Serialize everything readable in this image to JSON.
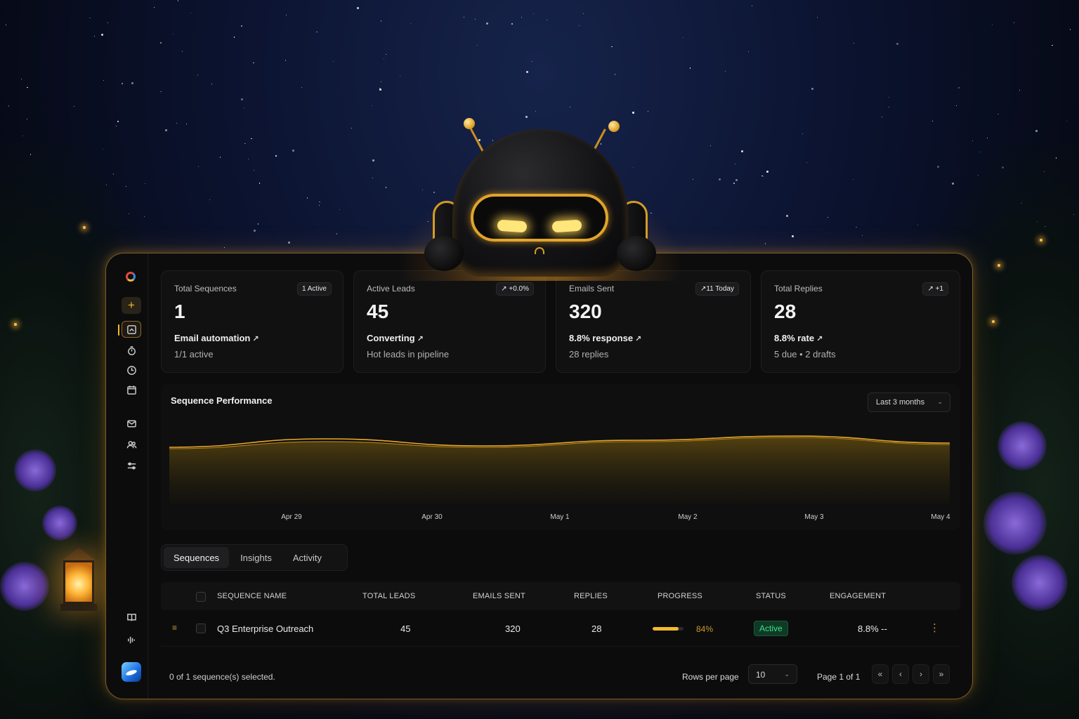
{
  "colors": {
    "accent": "#f2b930",
    "status_active": "#3ee08a",
    "panel_bg": "#0c0c0d"
  },
  "sidebar": {
    "items": [
      {
        "name": "add",
        "icon": "plus-icon"
      },
      {
        "name": "dashboard",
        "icon": "dashboard-icon"
      },
      {
        "name": "timer",
        "icon": "timer-icon"
      },
      {
        "name": "history",
        "icon": "clock-icon"
      },
      {
        "name": "calendar",
        "icon": "calendar-icon"
      },
      {
        "name": "mail",
        "icon": "mail-icon"
      },
      {
        "name": "users",
        "icon": "users-icon"
      },
      {
        "name": "settings",
        "icon": "sliders-icon"
      },
      {
        "name": "docs",
        "icon": "book-icon"
      },
      {
        "name": "audio",
        "icon": "waveform-icon"
      }
    ]
  },
  "cards": [
    {
      "label": "Total Sequences",
      "badge": "1 Active",
      "value": "1",
      "sub1": "Email automation",
      "sub2": "1/1 active"
    },
    {
      "label": "Active Leads",
      "badge": "↗ +0.0%",
      "value": "45",
      "sub1": "Converting",
      "sub2": "Hot leads in pipeline"
    },
    {
      "label": "Emails Sent",
      "badge": "↗11 Today",
      "value": "320",
      "sub1": "8.8% response",
      "sub2": "28 replies"
    },
    {
      "label": "Total Replies",
      "badge": "↗ +1",
      "value": "28",
      "sub1": "8.8% rate",
      "sub2": "5 due • 2 drafts"
    }
  ],
  "chart": {
    "title": "Sequence Performance",
    "range_label": "Last 3 months"
  },
  "chart_data": {
    "type": "area",
    "title": "Sequence Performance",
    "x": [
      "Apr 29",
      "Apr 30",
      "May 1",
      "May 2",
      "May 3",
      "May 4"
    ],
    "tick_labels": [
      "Apr 29",
      "Apr 30",
      "May 1",
      "May 2",
      "May 3",
      "May 4"
    ],
    "series": [
      {
        "values": [
          40,
          46,
          41,
          45,
          48,
          43
        ]
      },
      {
        "values": [
          39,
          44,
          40,
          44,
          47,
          42
        ]
      }
    ],
    "ylim": [
      0,
      60
    ],
    "grid": false,
    "xlabel": "",
    "ylabel": ""
  },
  "tabs": [
    {
      "label": "Sequences",
      "active": true
    },
    {
      "label": "Insights",
      "active": false
    },
    {
      "label": "Activity",
      "active": false
    }
  ],
  "table": {
    "headers": [
      "SEQUENCE NAME",
      "TOTAL LEADS",
      "EMAILS SENT",
      "REPLIES",
      "PROGRESS",
      "STATUS",
      "ENGAGEMENT"
    ],
    "rows": [
      {
        "name": "Q3 Enterprise Outreach",
        "total_leads": "45",
        "emails_sent": "320",
        "replies": "28",
        "progress": 0.84,
        "progress_label": "84%",
        "status": "Active",
        "engagement": "8.8% --"
      }
    ]
  },
  "footer": {
    "selected_text": "0 of 1 sequence(s) selected.",
    "rows_per_page_label": "Rows per page",
    "rows_per_page_value": "10",
    "page_label": "Page 1 of 1",
    "pager": [
      "«",
      "‹",
      "›",
      "»"
    ]
  }
}
